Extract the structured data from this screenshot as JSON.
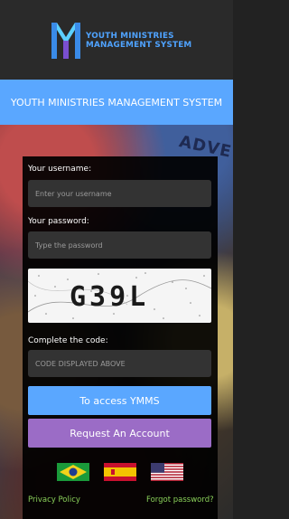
{
  "brand": {
    "line1": "YOUTH MINISTRIES",
    "line2": "MANAGEMENT SYSTEM",
    "icon": "ym-logo-icon"
  },
  "title": "YOUTH MINISTRIES MANAGEMENT SYSTEM",
  "background_text": "ADVE",
  "form": {
    "username_label": "Your username:",
    "username_placeholder": "Enter your username",
    "username_value": "",
    "password_label": "Your password:",
    "password_placeholder": "Type the password",
    "password_value": "",
    "captcha_text": "G39L",
    "code_label": "Complete the code:",
    "code_placeholder": "CODE DISPLAYED ABOVE",
    "code_value": ""
  },
  "buttons": {
    "access": "To access YMMS",
    "request": "Request An Account"
  },
  "languages": [
    {
      "name": "brazil-flag-icon"
    },
    {
      "name": "spain-flag-icon"
    },
    {
      "name": "usa-flag-icon"
    }
  ],
  "footer": {
    "privacy": "Privacy Policy",
    "forgot": "Forgot password?"
  },
  "colors": {
    "accent_blue": "#5aa7ff",
    "accent_purple": "#9b6cc6",
    "link_green": "#8ad05a"
  }
}
